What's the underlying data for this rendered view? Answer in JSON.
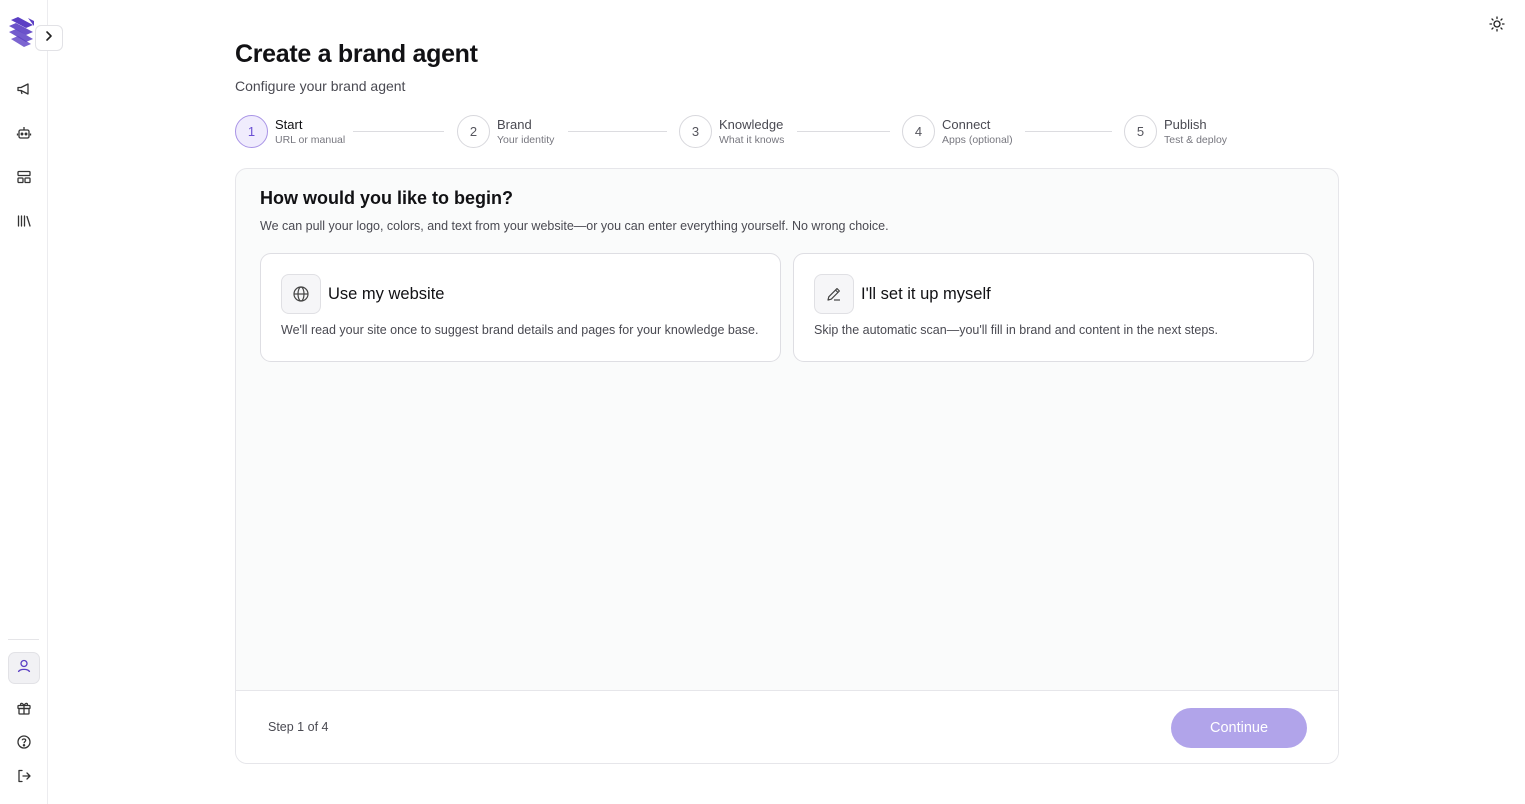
{
  "header": {
    "title": "Create a brand agent",
    "subtitle": "Configure your brand agent"
  },
  "steps": [
    {
      "number": "1",
      "label": "Start",
      "sub": "URL or manual",
      "active": true
    },
    {
      "number": "2",
      "label": "Brand",
      "sub": "Your identity",
      "active": false
    },
    {
      "number": "3",
      "label": "Knowledge",
      "sub": "What it knows",
      "active": false
    },
    {
      "number": "4",
      "label": "Connect",
      "sub": "Apps (optional)",
      "active": false
    },
    {
      "number": "5",
      "label": "Publish",
      "sub": "Test & deploy",
      "active": false
    }
  ],
  "card": {
    "title": "How would you like to begin?",
    "description": "We can pull your logo, colors, and text from your website—or you can enter everything yourself. No wrong choice.",
    "options": [
      {
        "title": "Use my website",
        "description": "We'll read your site once to suggest brand details and pages for your knowledge base.",
        "icon": "globe-icon"
      },
      {
        "title": "I'll set it up myself",
        "description": "Skip the automatic scan—you'll fill in brand and content in the next steps.",
        "icon": "pencil-icon"
      }
    ],
    "footer": {
      "step_count": "Step 1 of 4",
      "continue_label": "Continue"
    }
  },
  "sidebar": {
    "icons": [
      "megaphone-icon",
      "bot-icon",
      "layout-icon",
      "library-icon"
    ],
    "bottom_icons": [
      "user-icon",
      "gift-icon",
      "help-icon",
      "logout-icon"
    ]
  },
  "colors": {
    "accent": "#6a4fd3",
    "accent_light": "#f0ecfd",
    "button_disabled": "#b1a4ea",
    "logo": "#5b3fc4"
  }
}
